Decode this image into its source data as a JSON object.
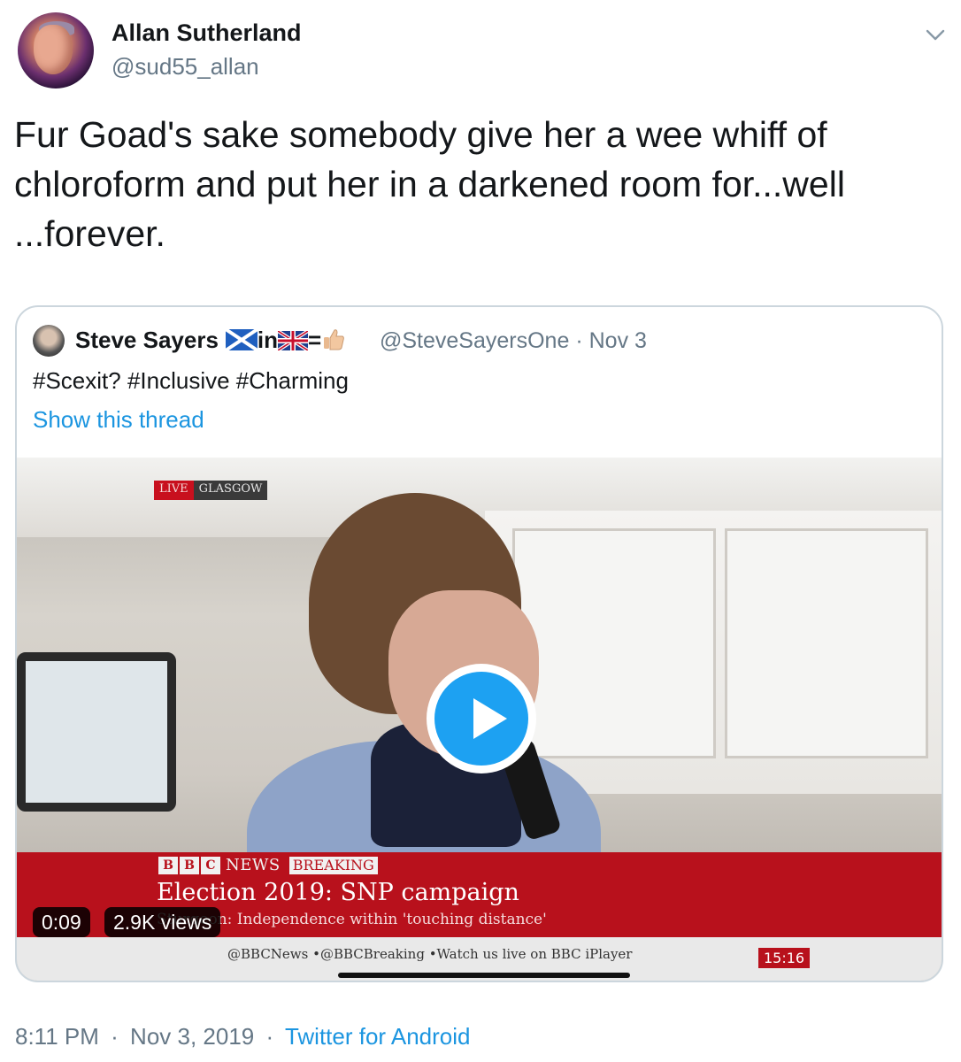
{
  "author": {
    "name": "Allan Sutherland",
    "handle": "@sud55_allan"
  },
  "tweet": {
    "text": "Fur Goad's sake somebody give her a wee whiff of chloroform and put her in a darkened room for...well ...forever."
  },
  "quoted": {
    "name": "Steve Sayers",
    "name_in": "in",
    "name_eq": "=",
    "handle": "@SteveSayersOne",
    "date": "Nov 3",
    "text": "#Scexit? #Inclusive #Charming",
    "show_thread": "Show this thread",
    "video": {
      "live": "LIVE",
      "location": "GLASGOW",
      "bbc_letters": [
        "B",
        "B",
        "C"
      ],
      "news": "NEWS",
      "breaking": "BREAKING",
      "headline": "Election 2019: SNP campaign",
      "subheadline": "Sturgeon: Independence within 'touching distance'",
      "ticker": "@BBCNews  •@BBCBreaking  •Watch us live on BBC iPlayer",
      "clock": "15:16",
      "duration": "0:09",
      "views": "2.9K views"
    }
  },
  "footer": {
    "time": "8:11 PM",
    "date": "Nov 3, 2019",
    "separator": "·",
    "source": "Twitter for Android"
  },
  "colors": {
    "link": "#1b95e0",
    "secondary_text": "#657786",
    "play_button": "#1da1f2",
    "bbc_red": "#b8111c"
  },
  "icons": {
    "menu": "chevron-down-icon",
    "play": "play-icon",
    "emoji_flag_scotland": "scotland-flag-icon",
    "emoji_flag_uk": "uk-flag-icon",
    "emoji_thumbs_up": "thumbs-up-icon"
  }
}
